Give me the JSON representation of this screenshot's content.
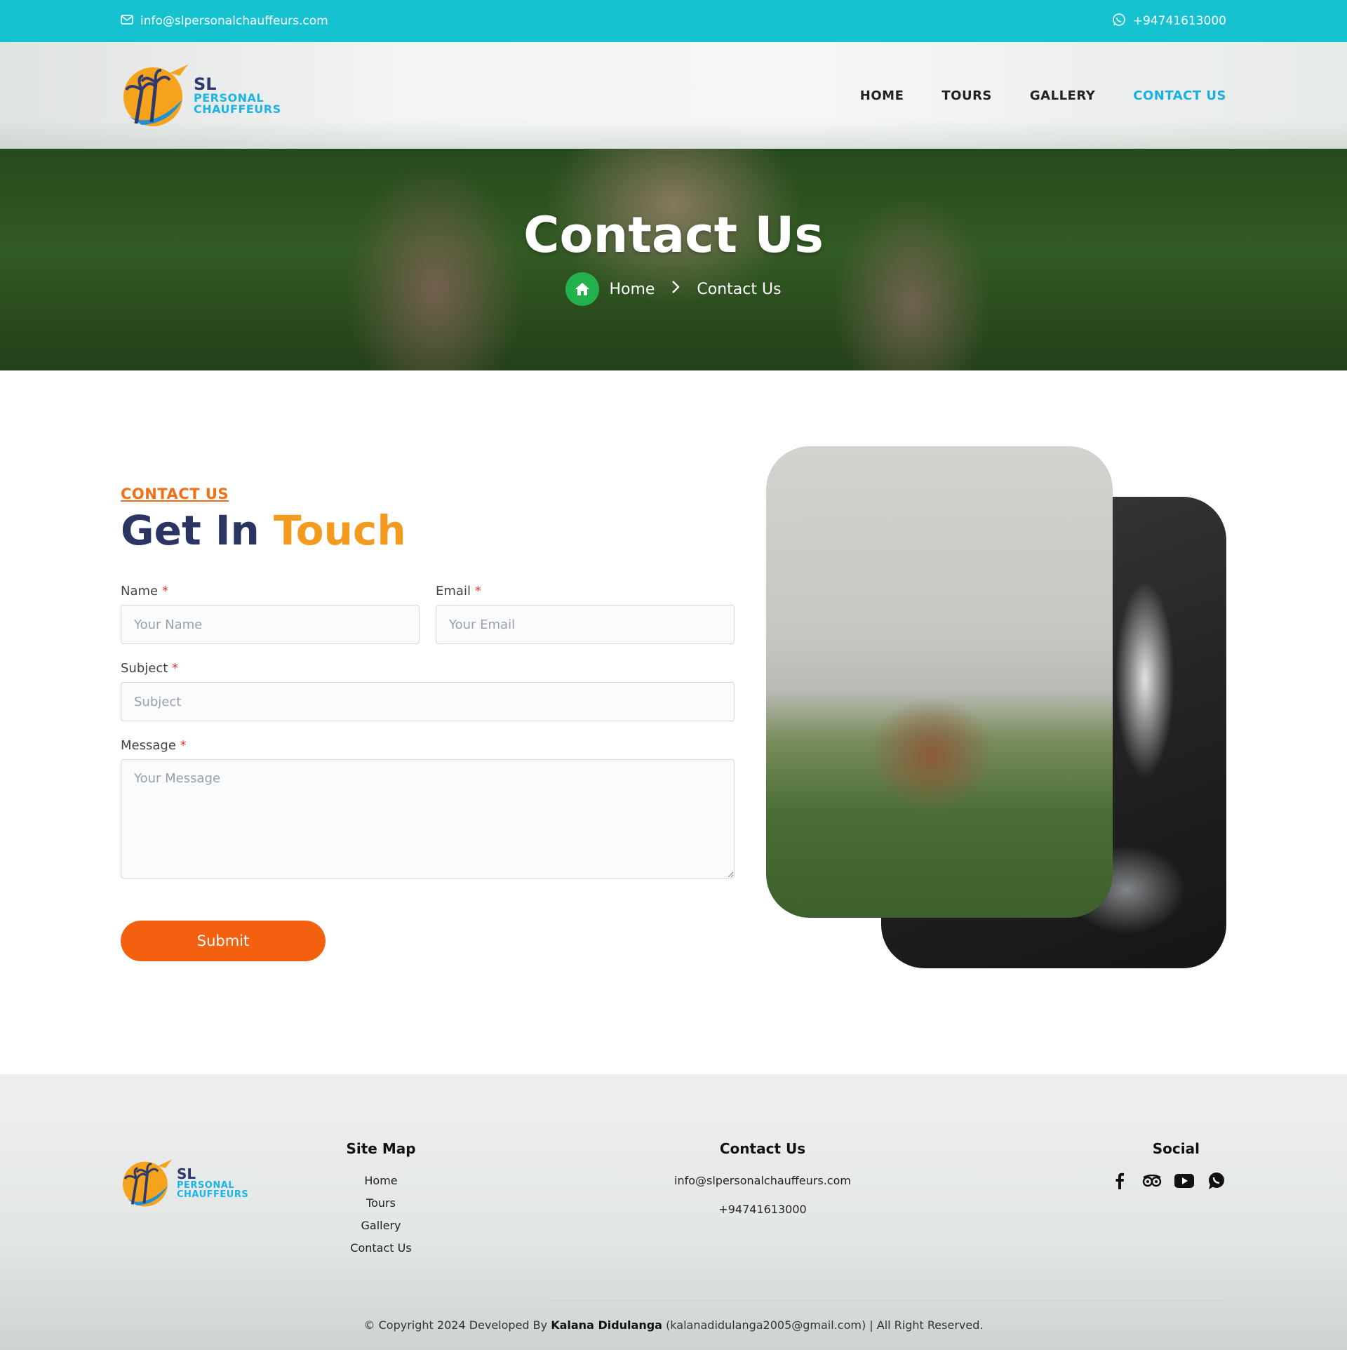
{
  "colors": {
    "topbar": "#17c2d0",
    "accent_orange": "#f26010",
    "accent_blue": "#1ab0e4",
    "title_navy": "#2b3563",
    "title_gold": "#f39a1f",
    "home_green": "#22b14c"
  },
  "topbar": {
    "email": "info@slpersonalchauffeurs.com",
    "phone": "+94741613000"
  },
  "logo": {
    "line1": "SL",
    "line2": "PERSONAL",
    "line3": "CHAUFFEURS"
  },
  "nav": {
    "home": "HOME",
    "tours": "TOURS",
    "gallery": "GALLERY",
    "contact": "CONTACT US"
  },
  "hero": {
    "title": "Contact Us",
    "crumb_home": "Home",
    "crumb_current": "Contact Us"
  },
  "section": {
    "kicker": "CONTACT US",
    "title_part1": "Get In",
    "title_part2": "Touch"
  },
  "form": {
    "name_label": "Name",
    "name_placeholder": "Your Name",
    "email_label": "Email",
    "email_placeholder": "Your Email",
    "subject_label": "Subject",
    "subject_placeholder": "Subject",
    "message_label": "Message",
    "message_placeholder": "Your Message",
    "required_mark": "*",
    "submit_label": "Submit"
  },
  "footer": {
    "sitemap_title": "Site Map",
    "sitemap_links": [
      "Home",
      "Tours",
      "Gallery",
      "Contact Us"
    ],
    "contact_title": "Contact Us",
    "contact_email": "info@slpersonalchauffeurs.com",
    "contact_phone": "+94741613000",
    "social_title": "Social",
    "social_icons": [
      "facebook-icon",
      "tripadvisor-icon",
      "youtube-icon",
      "whatsapp-icon"
    ],
    "copyright_prefix": "© Copyright 2024 Developed By",
    "developer": "Kalana Didulanga",
    "copyright_suffix": "(kalanadidulanga2005@gmail.com) | All Right Reserved."
  }
}
